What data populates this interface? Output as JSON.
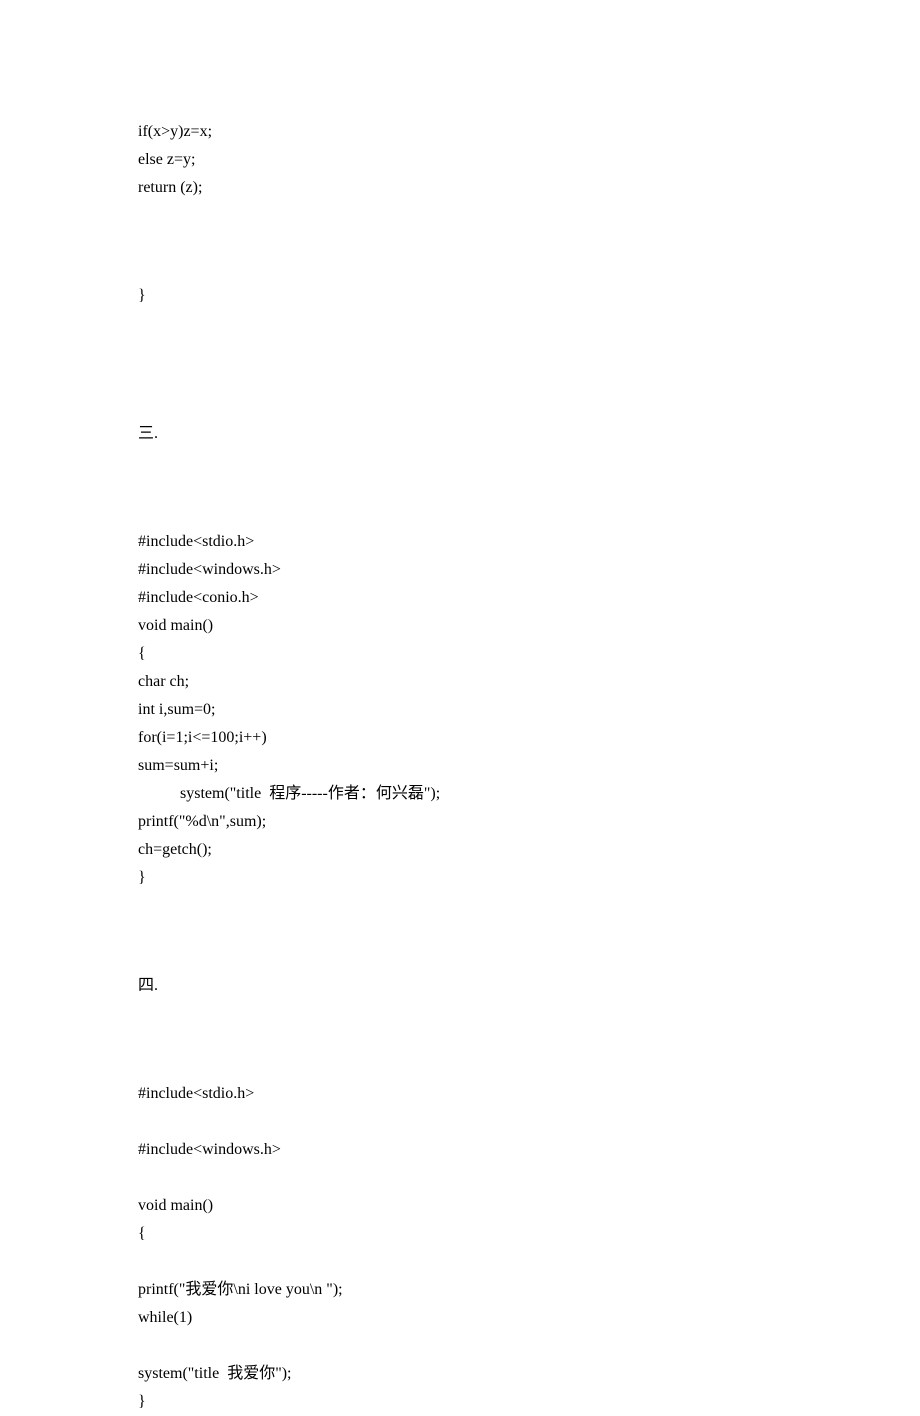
{
  "block1": {
    "lines": [
      "if(x>y)z=x;",
      "else z=y;",
      "return (z);"
    ],
    "closebrace": "}"
  },
  "section3": {
    "heading": "三.",
    "lines": [
      "#include<stdio.h>",
      "#include<windows.h>",
      "#include<conio.h>",
      "void main()",
      "{",
      "char ch;",
      "int i,sum=0;",
      "for(i=1;i<=100;i++)",
      "sum=sum+i;"
    ],
    "indented": "system(\"title  程序-----作者：何兴磊\");",
    "lines2": [
      "printf(\"%d\\n\",sum);",
      "ch=getch();",
      "}"
    ]
  },
  "section4": {
    "heading": "四.",
    "line1": "#include<stdio.h>",
    "line2": "#include<windows.h>",
    "line3": "void main()",
    "line4": "{",
    "line5": "printf(\"我爱你\\ni love you\\n \");",
    "line6": "while(1)",
    "line7": "system(\"title  我爱你\");",
    "line8": "}"
  }
}
